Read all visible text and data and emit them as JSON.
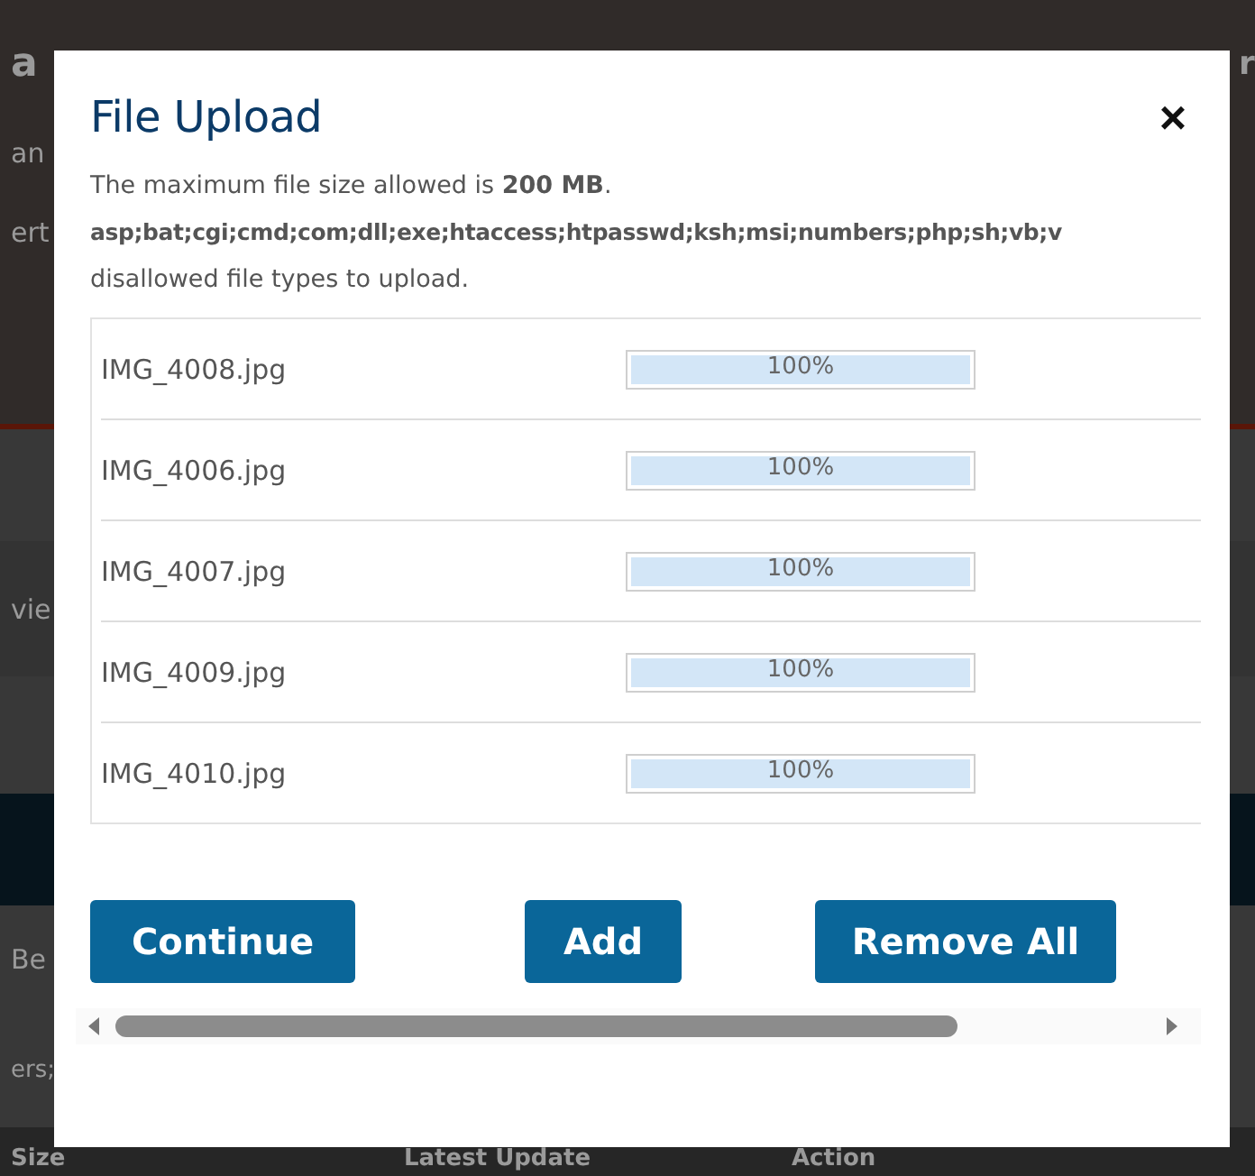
{
  "background": {
    "heading_start": "a",
    "heading_end": "r",
    "fragments": [
      "an",
      "ert",
      "vie",
      "Be",
      "ers;"
    ],
    "table_columns": [
      "Size",
      "Latest Update",
      "Action"
    ]
  },
  "dialog": {
    "title": "File Upload",
    "close": "×",
    "notes": [
      "The maximum file size allowed is **200 MB**.",
      "asp;bat;cgi;cmd;com;dll;exe;htaccess;htpasswd;ksh;msi;numbers;php;sh;vb;v",
      "disallowed file types to upload."
    ],
    "files": [
      {
        "name": "IMG_4008.jpg",
        "level": 1,
        "reading": "100%"
      },
      {
        "name": "IMG_4006.jpg",
        "level": 1,
        "reading": "100%"
      },
      {
        "name": "IMG_4007.jpg",
        "level": 1,
        "reading": "100%"
      },
      {
        "name": "IMG_4009.jpg",
        "level": 1,
        "reading": "100%"
      },
      {
        "name": "IMG_4010.jpg",
        "level": 1,
        "reading": "100%"
      }
    ],
    "buttons": [
      "Continue",
      "Add",
      "Remove All"
    ]
  }
}
